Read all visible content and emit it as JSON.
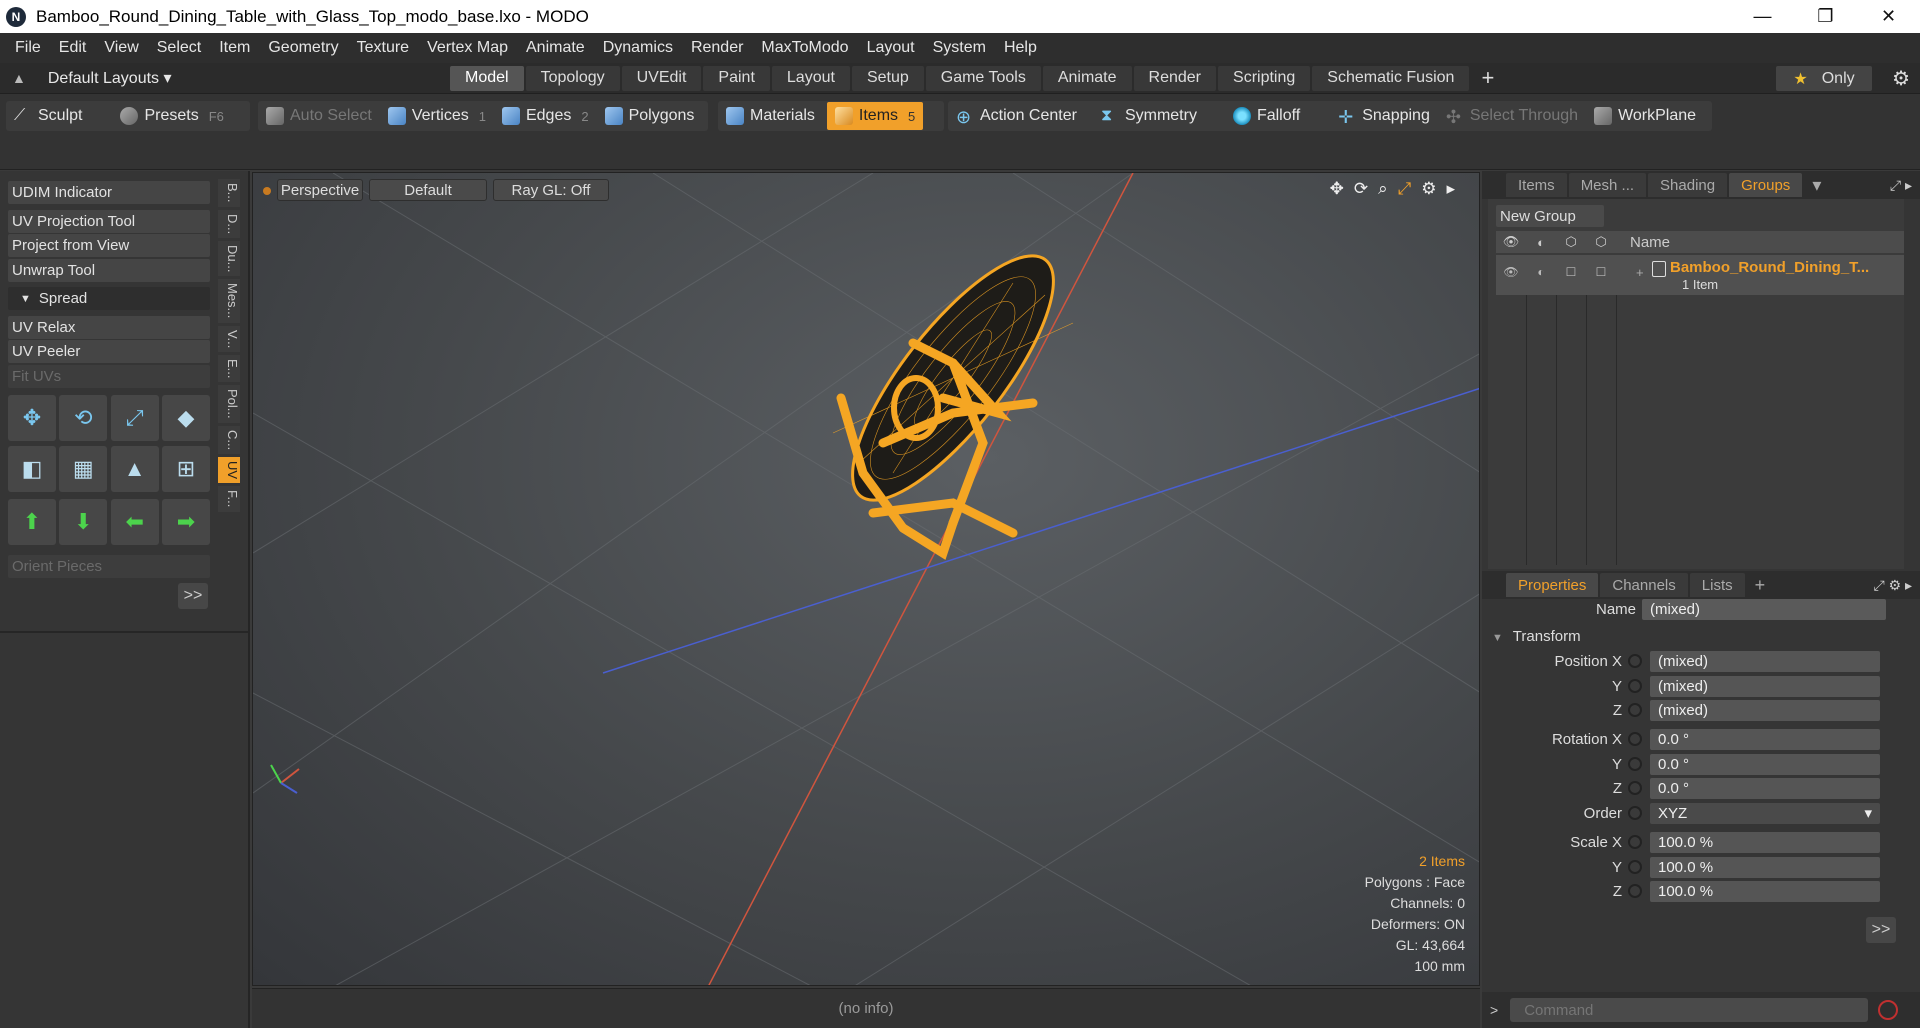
{
  "window": {
    "title": "Bamboo_Round_Dining_Table_with_Glass_Top_modo_base.lxo - MODO",
    "app_icon_glyph": "N",
    "minimize_glyph": "—",
    "maximize_glyph": "❐",
    "close_glyph": "✕"
  },
  "menu": [
    "File",
    "Edit",
    "View",
    "Select",
    "Item",
    "Geometry",
    "Texture",
    "Vertex Map",
    "Animate",
    "Dynamics",
    "Render",
    "MaxToModo",
    "Layout",
    "System",
    "Help"
  ],
  "layouts": {
    "label": "Default Layouts ▾",
    "only": "Only"
  },
  "tabs": [
    {
      "label": "Model",
      "active": true
    },
    {
      "label": "Topology",
      "active": false
    },
    {
      "label": "UVEdit",
      "active": false
    },
    {
      "label": "Paint",
      "active": false
    },
    {
      "label": "Layout",
      "active": false
    },
    {
      "label": "Setup",
      "active": false
    },
    {
      "label": "Game Tools",
      "active": false
    },
    {
      "label": "Animate",
      "active": false
    },
    {
      "label": "Render",
      "active": false
    },
    {
      "label": "Scripting",
      "active": false
    },
    {
      "label": "Schematic Fusion",
      "active": false
    }
  ],
  "toolbar": {
    "sculpt": "Sculpt",
    "presets": "Presets",
    "presets_key": "F6",
    "auto_select": "Auto Select",
    "vertices": "Vertices",
    "vertices_key": "1",
    "edges": "Edges",
    "edges_key": "2",
    "polygons": "Polygons",
    "materials": "Materials",
    "items": "Items",
    "items_key": "5",
    "action_center": "Action Center",
    "symmetry": "Symmetry",
    "falloff": "Falloff",
    "snapping": "Snapping",
    "select_through": "Select Through",
    "workplane": "WorkPlane"
  },
  "left_panel": {
    "buttons": [
      "UDIM Indicator",
      "UV Projection Tool",
      "Project from View",
      "Unwrap Tool",
      "Spread",
      "UV Relax",
      "UV Peeler",
      "Fit UVs"
    ],
    "orient_pieces": "Orient Pieces",
    "more": ">>",
    "vtabs": [
      "B...",
      "D...",
      "Du...",
      "Mes...",
      "V...",
      "E...",
      "Pol...",
      "C...",
      "UV",
      "F..."
    ]
  },
  "viewport": {
    "view": "Perspective",
    "shading": "Default",
    "raygl": "Ray GL: Off",
    "info": {
      "items": "2 Items",
      "polygons": "Polygons : Face",
      "channels": "Channels: 0",
      "deformers": "Deformers: ON",
      "gl": "GL: 43,664",
      "unit": "100 mm"
    },
    "colors": {
      "wire": "#f5a623",
      "x_axis": "#d0553e",
      "z_axis": "#4a5fd0"
    }
  },
  "status": "(no info)",
  "groups_panel": {
    "tabs": [
      {
        "label": "Items",
        "active": false
      },
      {
        "label": "Mesh ...",
        "active": false
      },
      {
        "label": "Shading",
        "active": false
      },
      {
        "label": "Groups",
        "active": true
      }
    ],
    "new_group": "New Group",
    "name_header": "Name",
    "group_name": "Bamboo_Round_Dining_T...",
    "group_count": "1 Item"
  },
  "properties_panel": {
    "tabs": [
      {
        "label": "Properties",
        "active": true
      },
      {
        "label": "Channels",
        "active": false
      },
      {
        "label": "Lists",
        "active": false
      }
    ],
    "name_label": "Name",
    "name_value": "(mixed)",
    "transform": "Transform",
    "rows": [
      {
        "label": "Position X",
        "value": "(mixed)"
      },
      {
        "label": "Y",
        "value": "(mixed)"
      },
      {
        "label": "Z",
        "value": "(mixed)"
      },
      {
        "label": "Rotation X",
        "value": "0.0 °"
      },
      {
        "label": "Y",
        "value": "0.0 °"
      },
      {
        "label": "Z",
        "value": "0.0 °"
      },
      {
        "label": "Order",
        "value": "XYZ"
      },
      {
        "label": "Scale X",
        "value": "100.0 %"
      },
      {
        "label": "Y",
        "value": "100.0 %"
      },
      {
        "label": "Z",
        "value": "100.0 %"
      }
    ],
    "more": ">>"
  },
  "command": {
    "placeholder": "Command",
    "arrow": ">"
  }
}
